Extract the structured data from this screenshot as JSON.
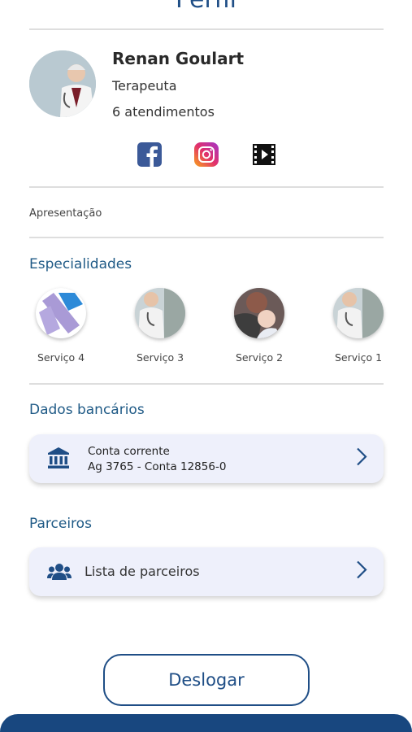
{
  "header": {
    "title": "Perfil"
  },
  "profile": {
    "name": "Renan Goulart",
    "role": "Terapeuta",
    "appointments": "6 atendimentos"
  },
  "social": [
    "facebook-icon",
    "instagram-icon",
    "video-icon"
  ],
  "presentation_label": "Apresentação",
  "specialties": {
    "title": "Especialidades",
    "items": [
      {
        "label": "Serviço 4"
      },
      {
        "label": "Serviço 3"
      },
      {
        "label": "Serviço 2"
      },
      {
        "label": "Serviço 1"
      }
    ]
  },
  "bank": {
    "title": "Dados bancários",
    "account_type": "Conta corrente",
    "account_details": "Ag 3765 - Conta 12856-0"
  },
  "partners": {
    "title": "Parceiros",
    "list_label": "Lista de parceiros"
  },
  "logout_label": "Deslogar",
  "colors": {
    "primary": "#1f4e86",
    "card_bg": "#eef0fb",
    "section": "#1f5a86"
  }
}
